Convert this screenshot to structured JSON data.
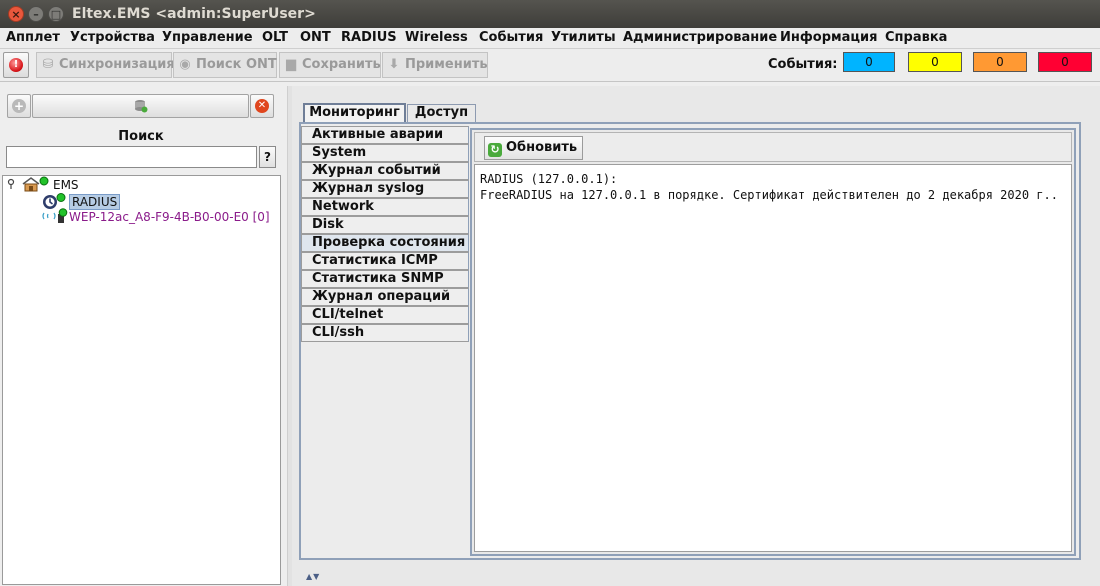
{
  "window": {
    "title": "Eltex.EMS <admin:SuperUser>"
  },
  "menu": [
    "Апплет",
    "Устройства",
    "Управление",
    "OLT",
    "ONT",
    "RADIUS",
    "Wireless",
    "События",
    "Утилиты",
    "Администрирование",
    "Информация",
    "Справка"
  ],
  "toolbar": {
    "sync_label": "Синхронизация",
    "ont_search_label": "Поиск ONT",
    "save_label": "Сохранить",
    "apply_label": "Применить",
    "events_label": "События:",
    "events": [
      {
        "value": "0",
        "color": "#00b4ff"
      },
      {
        "value": "0",
        "color": "#ffff00"
      },
      {
        "value": "0",
        "color": "#ff9933"
      },
      {
        "value": "0",
        "color": "#ff0033"
      }
    ]
  },
  "left": {
    "search_label": "Поиск",
    "search_value": "",
    "help_label": "?",
    "tree": {
      "root": "EMS",
      "radius": "RADIUS",
      "wep": "WEP-12ac_A8-F9-4B-B0-00-E0 [0]"
    }
  },
  "tabs": [
    "Мониторинг",
    "Доступ"
  ],
  "side_tabs": [
    "Активные аварии",
    "System",
    "Журнал событий",
    "Журнал syslog",
    "Network",
    "Disk",
    "Проверка состояния",
    "Статистика ICMP",
    "Статистика SNMP",
    "Журнал операций",
    "CLI/telnet",
    "CLI/ssh"
  ],
  "content": {
    "refresh_label": "Обновить",
    "output_lines": [
      "RADIUS (127.0.0.1):",
      "FreeRADIUS на 127.0.0.1 в порядке. Сертификат действителен до 2 декабря 2020 г.."
    ]
  }
}
